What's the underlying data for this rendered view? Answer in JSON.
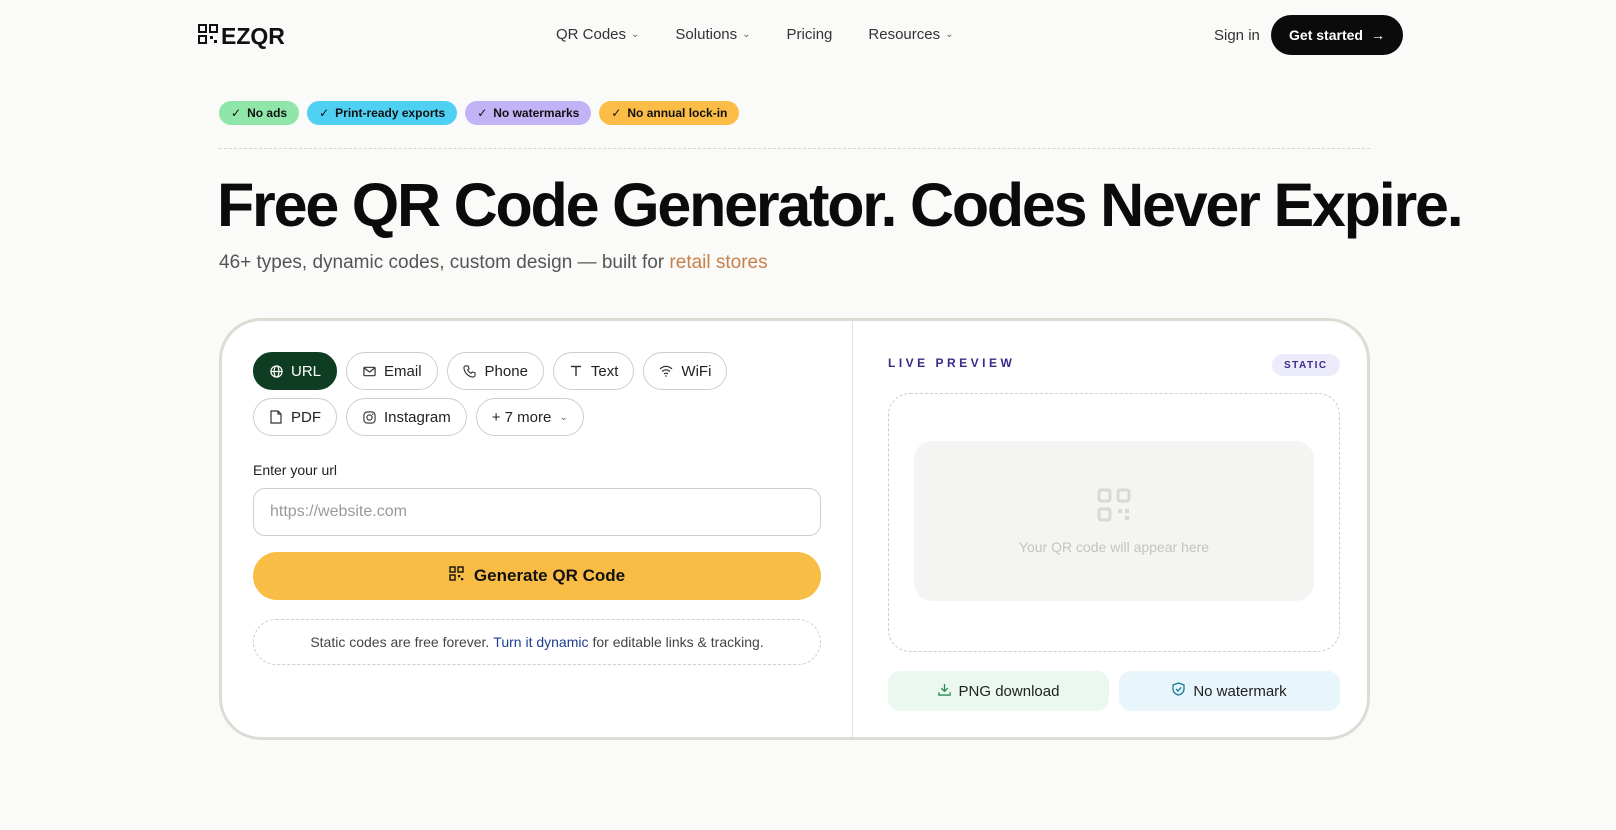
{
  "nav": {
    "logo": "EZQR",
    "links": [
      {
        "label": "QR Codes",
        "dropdown": true
      },
      {
        "label": "Solutions",
        "dropdown": true
      },
      {
        "label": "Pricing",
        "dropdown": false
      },
      {
        "label": "Resources",
        "dropdown": true
      }
    ],
    "signin": "Sign in",
    "cta": "Get started"
  },
  "badges": [
    {
      "label": "No ads",
      "color": "#8fe6a8"
    },
    {
      "label": "Print-ready exports",
      "color": "#4dd0f2"
    },
    {
      "label": "No watermarks",
      "color": "#c2b3f7"
    },
    {
      "label": "No annual lock-in",
      "color": "#fbbd45"
    }
  ],
  "hero": {
    "title": "Free QR Code Generator. Codes Never Expire.",
    "subtitle": "46+ types, dynamic codes, custom design — built for",
    "subtitle_accent": "retail stores"
  },
  "form": {
    "types": [
      {
        "label": "URL",
        "icon": "globe-icon",
        "active": true
      },
      {
        "label": "Email",
        "icon": "mail-icon",
        "active": false
      },
      {
        "label": "Phone",
        "icon": "phone-icon",
        "active": false
      },
      {
        "label": "Text",
        "icon": "text-icon",
        "active": false
      },
      {
        "label": "WiFi",
        "icon": "wifi-icon",
        "active": false
      },
      {
        "label": "PDF",
        "icon": "pdf-icon",
        "active": false
      },
      {
        "label": "Instagram",
        "icon": "instagram-icon",
        "active": false
      },
      {
        "label": "+ 7 more",
        "icon": "chevron-down-icon",
        "active": false
      }
    ],
    "field_label": "Enter your url",
    "placeholder": "https://website.com",
    "generate": "Generate QR Code",
    "note_prefix": "Static codes are free forever.",
    "note_link": "Turn it dynamic",
    "note_suffix": "for editable links & tracking."
  },
  "preview": {
    "label": "LIVE PREVIEW",
    "mode": "STATIC",
    "placeholder": "Your QR code will appear here",
    "png": "PNG download",
    "watermark": "No watermark"
  }
}
